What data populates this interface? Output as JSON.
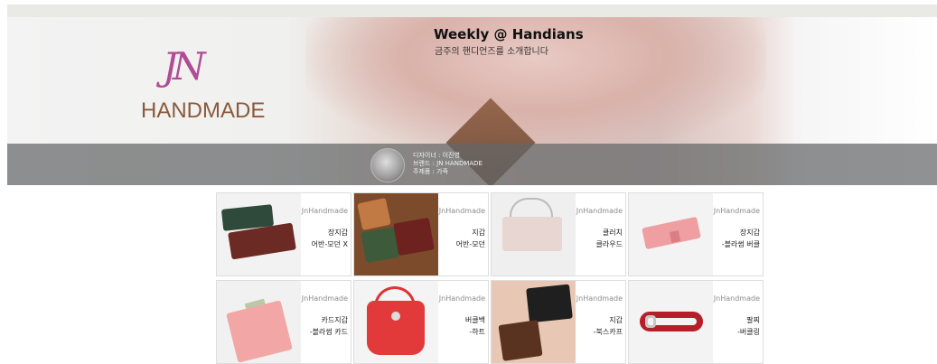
{
  "hero": {
    "title": "Weekly @ Handians",
    "subtitle": "금주의 핸디언즈를 소개합니다",
    "logo_script": "JN",
    "logo_text": "HANDMADE",
    "designer": "디자이너 : 이진영",
    "brand": "브랜드 : JN HANDMADE",
    "material": "주제품 : 가죽"
  },
  "products": [
    {
      "brand": "JnHandmade",
      "category": "장지갑",
      "name": "어반-모던 X",
      "thumb_bg": "#f2f2f2",
      "item_color": "#6b2a24",
      "icon": "long-wallet-icon"
    },
    {
      "brand": "JnHandmade",
      "category": "지갑",
      "name": "어반-모던",
      "thumb_bg": "#7c4b2c",
      "item_color": "#3d5a3a",
      "icon": "wallet-icon"
    },
    {
      "brand": "JnHandmade",
      "category": "클러치",
      "name": "클라우드",
      "thumb_bg": "#efefef",
      "item_color": "#e8d6d2",
      "icon": "clutch-icon"
    },
    {
      "brand": "JnHandmade",
      "category": "장지갑",
      "name": "-블라썸 버클",
      "thumb_bg": "#f3f3f3",
      "item_color": "#ef9ea1",
      "icon": "long-wallet-icon"
    },
    {
      "brand": "JnHandmade",
      "category": "카드지갑",
      "name": "-블라썸 카드",
      "thumb_bg": "#f1f1f1",
      "item_color": "#f2a7a6",
      "icon": "card-wallet-icon"
    },
    {
      "brand": "JnHandmade",
      "category": "버클백",
      "name": "-하트",
      "thumb_bg": "#f4f4f4",
      "item_color": "#e23a3a",
      "icon": "bag-icon"
    },
    {
      "brand": "JnHandmade",
      "category": "지갑",
      "name": "-북스카프",
      "thumb_bg": "#e8c8b4",
      "item_color": "#5a3220",
      "icon": "wallet-icon"
    },
    {
      "brand": "JnHandmade",
      "category": "팔찌",
      "name": "-버클링",
      "thumb_bg": "#f3f3f3",
      "item_color": "#b51f2a",
      "icon": "bracelet-icon"
    }
  ]
}
